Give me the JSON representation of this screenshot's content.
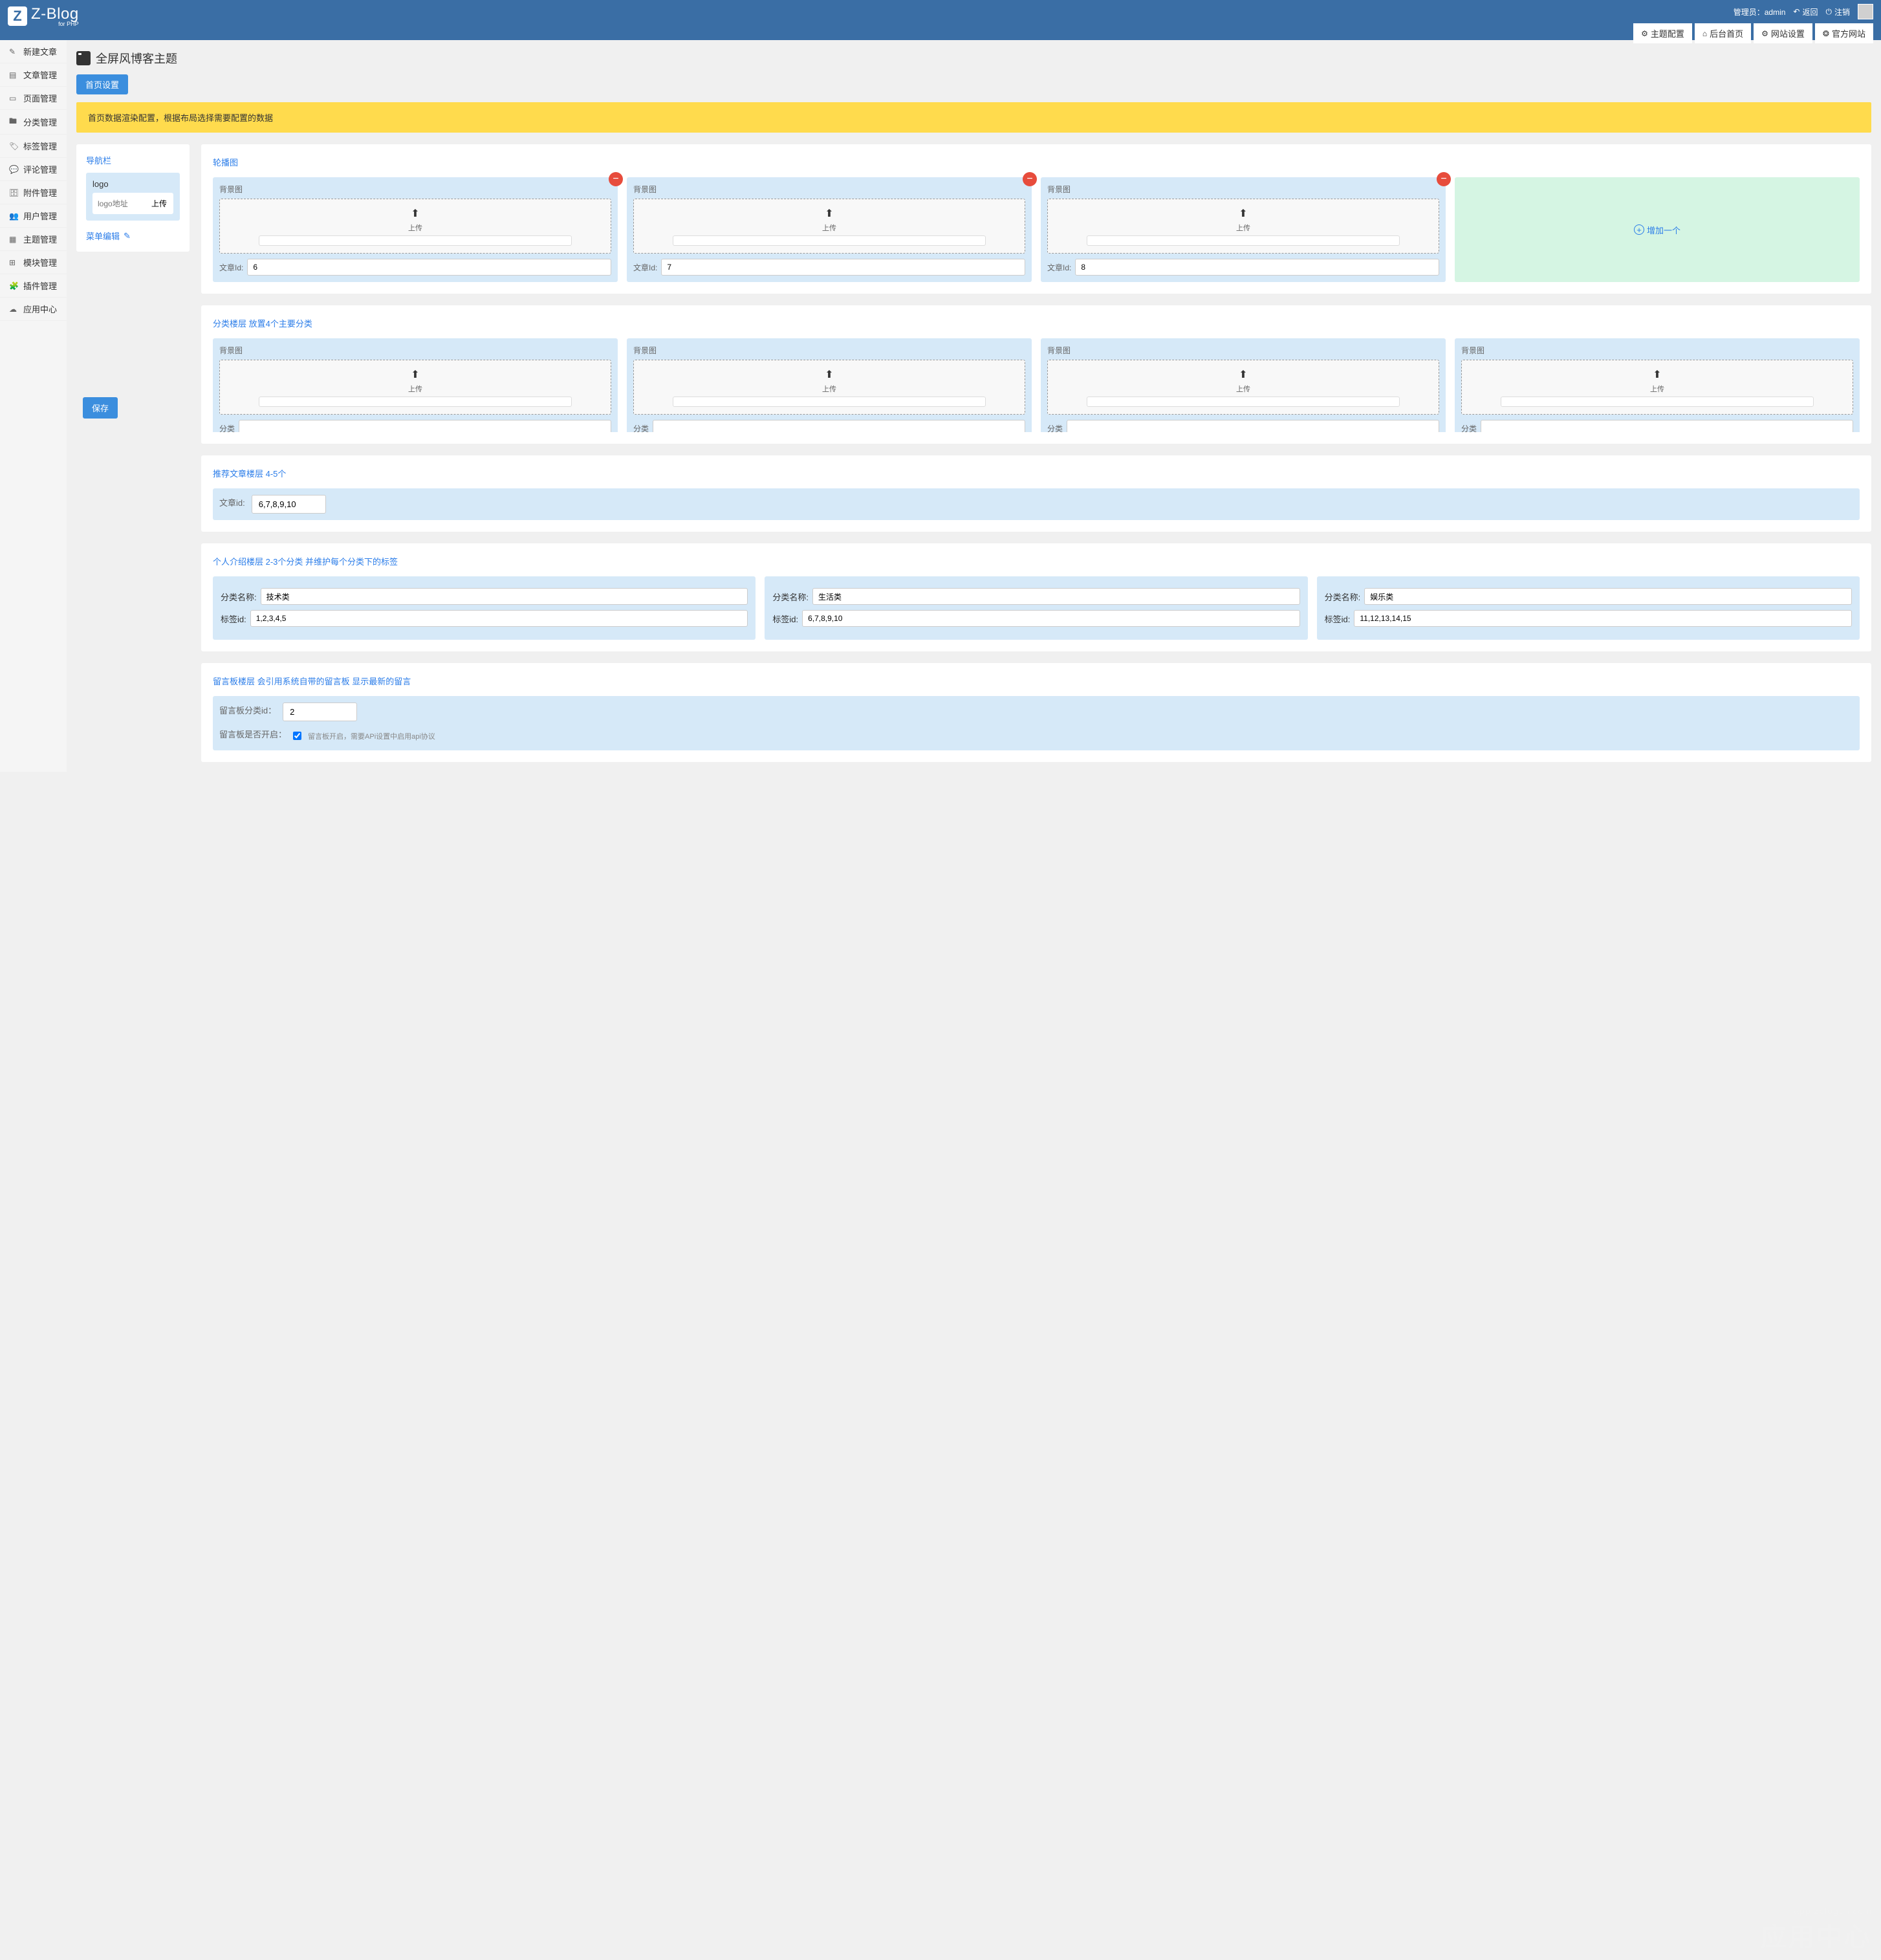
{
  "brand": {
    "letter": "Z",
    "name": "Z-Blog",
    "sub": "for PHP"
  },
  "admin": {
    "prefix": "管理员：",
    "name": "admin",
    "back": "返回",
    "logout": "注销"
  },
  "topTabs": [
    {
      "label": "主题配置",
      "icon": "gear"
    },
    {
      "label": "后台首页",
      "icon": "home"
    },
    {
      "label": "网站设置",
      "icon": "gear"
    },
    {
      "label": "官方网站",
      "icon": "globe"
    }
  ],
  "sidebar": [
    {
      "label": "新建文章",
      "icon": "✎"
    },
    {
      "label": "文章管理",
      "icon": "▤"
    },
    {
      "label": "页面管理",
      "icon": "▭"
    },
    {
      "label": "分类管理",
      "icon": "🖿"
    },
    {
      "label": "标签管理",
      "icon": "🏷"
    },
    {
      "label": "评论管理",
      "icon": "💬"
    },
    {
      "label": "附件管理",
      "icon": "🗄"
    },
    {
      "label": "用户管理",
      "icon": "👥"
    },
    {
      "label": "主题管理",
      "icon": "▦"
    },
    {
      "label": "模块管理",
      "icon": "⊞"
    },
    {
      "label": "插件管理",
      "icon": "🧩"
    },
    {
      "label": "应用中心",
      "icon": "☁"
    }
  ],
  "page": {
    "title": "全屏风博客主题",
    "subtab": "首页设置",
    "notice": "首页数据渲染配置，根据布局选择需要配置的数据"
  },
  "nav": {
    "title": "导航栏",
    "logoLabel": "logo",
    "logoPlaceholder": "logo地址",
    "uploadBtn": "上传",
    "menuEdit": "菜单编辑"
  },
  "carousel": {
    "title": "轮播图",
    "bgLabel": "背景图",
    "uploadText": "上传",
    "articleIdLabel": "文章Id:",
    "addText": "增加一个",
    "items": [
      {
        "articleId": "6"
      },
      {
        "articleId": "7"
      },
      {
        "articleId": "8"
      }
    ]
  },
  "category": {
    "title": "分类楼层 放置4个主要分类",
    "bgLabel": "背景图",
    "uploadText": "上传",
    "catLabel": "分类",
    "items": [
      {},
      {},
      {},
      {}
    ]
  },
  "recommend": {
    "title": "推荐文章楼层 4-5个",
    "label": "文章id:",
    "value": "6,7,8,9,10"
  },
  "intro": {
    "title": "个人介绍楼层 2-3个分类 并维护每个分类下的标签",
    "nameLabel": "分类名称:",
    "tagLabel": "标签id:",
    "items": [
      {
        "name": "技术类",
        "tags": "1,2,3,4,5"
      },
      {
        "name": "生活类",
        "tags": "6,7,8,9,10"
      },
      {
        "name": "娱乐类",
        "tags": "11,12,13,14,15"
      }
    ]
  },
  "guestbook": {
    "title": "留言板楼层 会引用系统自带的留言板 显示最新的留言",
    "catLabel": "留言板分类id：",
    "catValue": "2",
    "enableLabel": "留言板是否开启：",
    "enableChecked": true,
    "note": "留言板开启，需要APi设置中启用api协议"
  },
  "saveBtn": "保存",
  "watermark": {
    "url": "app.zblogcn.com",
    "text": "应用中心"
  }
}
